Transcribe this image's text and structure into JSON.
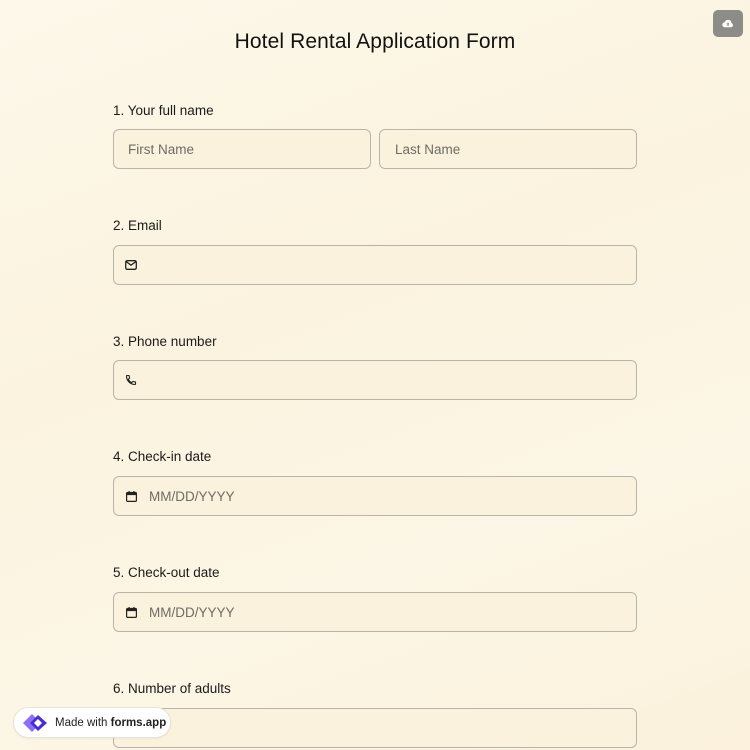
{
  "form": {
    "title": "Hotel Rental Application Form"
  },
  "questions": [
    {
      "label": "1.  Your full name",
      "first_placeholder": "First Name",
      "last_placeholder": "Last Name"
    },
    {
      "label": "2. Email",
      "icon": "envelope-icon"
    },
    {
      "label": "3. Phone number",
      "icon": "phone-icon"
    },
    {
      "label": "4. Check-in date",
      "icon": "calendar-icon",
      "placeholder": "MM/DD/YYYY"
    },
    {
      "label": "5. Check-out date",
      "icon": "calendar-icon",
      "placeholder": "MM/DD/YYYY"
    },
    {
      "label": "6. Number of adults"
    }
  ],
  "badge": {
    "prefix": "Made with",
    "brand": "forms.app"
  },
  "colors": {
    "background": "#fcf6e6",
    "field_bg": "#fbf2dd",
    "field_border": "#b9b4aa",
    "brand_purple": "#6b4fe0"
  }
}
